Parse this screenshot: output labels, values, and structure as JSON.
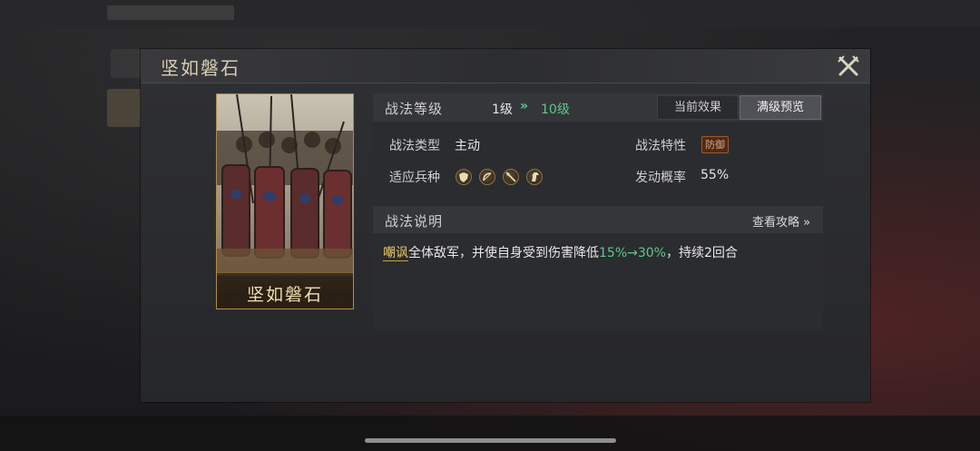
{
  "dialog": {
    "title": "坚如磐石",
    "close_icon": "close-crossed-swords-icon"
  },
  "card": {
    "name": "坚如磐石"
  },
  "level": {
    "label": "战法等级",
    "current": "1级",
    "arrow": "»",
    "max": "10级"
  },
  "tabs": {
    "current_effect": "当前效果",
    "max_preview": "满级预览"
  },
  "attributes": {
    "type_label": "战法类型",
    "type_value": "主动",
    "trait_label": "战法特性",
    "trait_value": "防御",
    "troops_label": "适应兵种",
    "troops": [
      "shield-icon",
      "bow-icon",
      "spear-icon",
      "horse-icon"
    ],
    "chance_label": "发动概率",
    "chance_value": "55%"
  },
  "description": {
    "label": "战法说明",
    "guide_link": "查看攻略 »",
    "keyword": "嘲讽",
    "text_1": "全体敌军，并使自身受到伤害降低",
    "scaling": "15%→30%",
    "text_2": "，持续2回合"
  },
  "colors": {
    "accent_green": "#5cc98a",
    "card_border": "#b08d46",
    "keyword_gold": "#e8c86a"
  }
}
